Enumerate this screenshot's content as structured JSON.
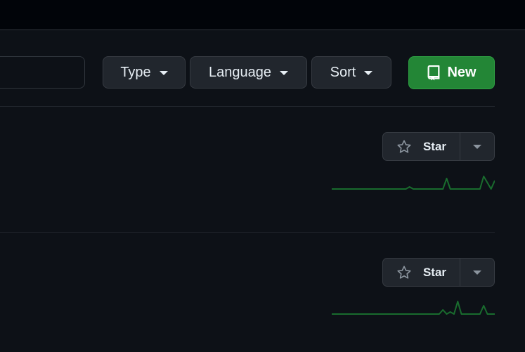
{
  "search": {
    "value": "",
    "placeholder": ""
  },
  "filters": [
    {
      "label": "Type",
      "icon": "chevron-down-icon"
    },
    {
      "label": "Language",
      "icon": "chevron-down-icon"
    },
    {
      "label": "Sort",
      "icon": "chevron-down-icon"
    }
  ],
  "new_button": {
    "label": "New",
    "icon": "repo-icon"
  },
  "repos": [
    {
      "star_label": "Star",
      "activity": [
        0,
        0,
        0,
        0,
        0,
        0,
        0,
        0,
        0,
        0,
        0,
        0,
        0,
        0,
        0,
        0,
        0,
        0,
        0,
        0,
        0,
        1,
        0,
        0,
        0,
        0,
        0,
        0,
        0,
        0,
        0,
        5,
        0,
        0,
        0,
        0,
        0,
        0,
        0,
        0,
        0,
        6,
        3,
        0,
        4
      ]
    },
    {
      "star_label": "Star",
      "activity": [
        0,
        0,
        0,
        0,
        0,
        0,
        0,
        0,
        0,
        0,
        0,
        0,
        0,
        0,
        0,
        0,
        0,
        0,
        0,
        0,
        0,
        0,
        0,
        0,
        0,
        0,
        0,
        0,
        0,
        0,
        2,
        0,
        1,
        0,
        6,
        0,
        0,
        0,
        0,
        0,
        0,
        4,
        0,
        0,
        0
      ]
    }
  ],
  "colors": {
    "accent_green": "#238636",
    "sparkline": "#196c2e",
    "background": "#0d1117"
  }
}
